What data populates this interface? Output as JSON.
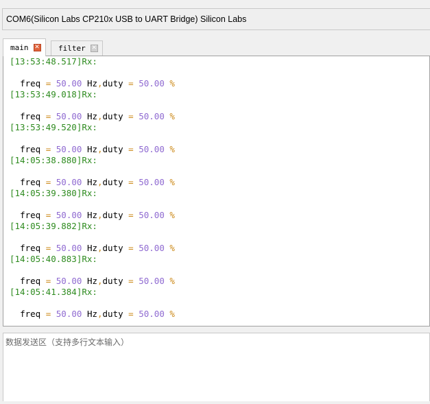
{
  "port": {
    "label": "COM6(Silicon Labs CP210x USB to UART Bridge) Silicon Labs"
  },
  "tabs": [
    {
      "label": "main",
      "active": true
    },
    {
      "label": "filter",
      "active": false
    }
  ],
  "log": {
    "entries": [
      {
        "timestamp": "[13:53:48.517]",
        "direction": "Rx:",
        "freq": "50.00",
        "freq_unit": "Hz",
        "duty": "50.00",
        "duty_unit": "%"
      },
      {
        "timestamp": "[13:53:49.018]",
        "direction": "Rx:",
        "freq": "50.00",
        "freq_unit": "Hz",
        "duty": "50.00",
        "duty_unit": "%"
      },
      {
        "timestamp": "[13:53:49.520]",
        "direction": "Rx:",
        "freq": "50.00",
        "freq_unit": "Hz",
        "duty": "50.00",
        "duty_unit": "%"
      },
      {
        "timestamp": "[14:05:38.880]",
        "direction": "Rx:",
        "freq": "50.00",
        "freq_unit": "Hz",
        "duty": "50.00",
        "duty_unit": "%"
      },
      {
        "timestamp": "[14:05:39.380]",
        "direction": "Rx:",
        "freq": "50.00",
        "freq_unit": "Hz",
        "duty": "50.00",
        "duty_unit": "%"
      },
      {
        "timestamp": "[14:05:39.882]",
        "direction": "Rx:",
        "freq": "50.00",
        "freq_unit": "Hz",
        "duty": "50.00",
        "duty_unit": "%"
      },
      {
        "timestamp": "[14:05:40.883]",
        "direction": "Rx:",
        "freq": "50.00",
        "freq_unit": "Hz",
        "duty": "50.00",
        "duty_unit": "%"
      },
      {
        "timestamp": "[14:05:41.384]",
        "direction": "Rx:",
        "freq": "50.00",
        "freq_unit": "Hz",
        "duty": "50.00",
        "duty_unit": "%"
      }
    ],
    "freq_key": "freq",
    "duty_key": "duty",
    "equals": "=",
    "comma": ","
  },
  "sender": {
    "placeholder": "数据发送区（支持多行文本输入）"
  },
  "colors": {
    "timestamp": "#2e8b1f",
    "number": "#8f6ad1",
    "operator": "#cc8a1a",
    "tab_close_active": "#e0623b"
  },
  "icons": {
    "tab_close": "close-icon"
  }
}
